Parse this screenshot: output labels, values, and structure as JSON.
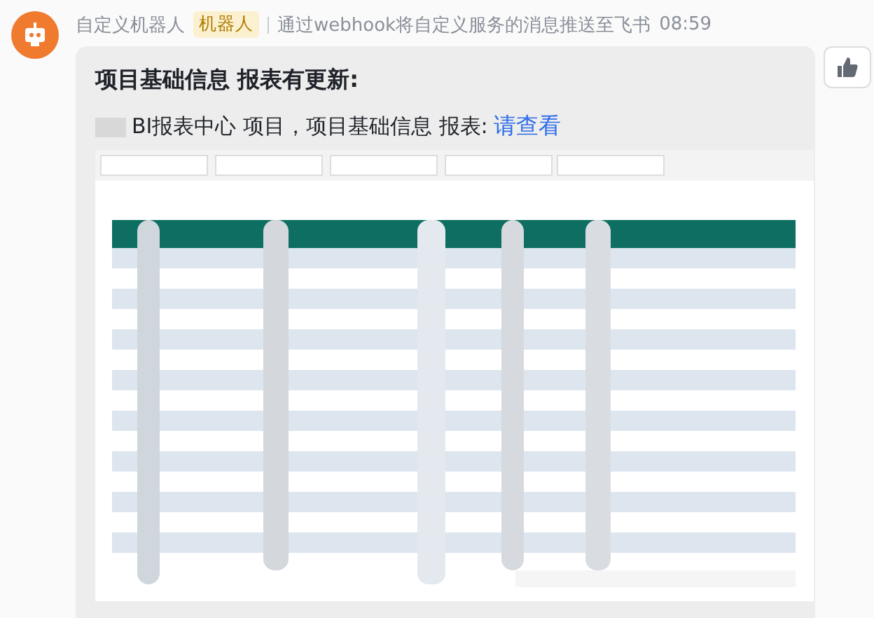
{
  "message": {
    "sender": "自定义机器人",
    "badge": "机器人",
    "description": "通过webhook将自定义服务的消息推送至飞书",
    "time": "08:59"
  },
  "card": {
    "title": "项目基础信息 报表有更新:",
    "text": "BI报表中心 项目，项目基础信息 报表:",
    "link": "请查看"
  }
}
